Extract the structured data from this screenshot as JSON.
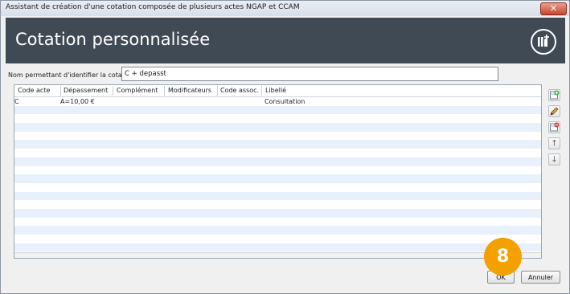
{
  "window": {
    "title": "Assistant de création d'une cotation composée de plusieurs actes NGAP et CCAM",
    "close_symbol": "✕"
  },
  "header": {
    "title": "Cotation personnalisée",
    "logo_icon": "medical-logo-icon"
  },
  "form": {
    "name_label": "Nom permettant d'identifier la cotation :",
    "name_value": "C + depasst"
  },
  "table": {
    "columns": [
      "Code acte",
      "Dépassement",
      "Complément",
      "Modificateurs",
      "Code assoc.",
      "Libellé"
    ],
    "rows": [
      {
        "code_acte": "C",
        "depassement": "A=10,00 €",
        "complement": "",
        "modificateurs": "",
        "code_assoc": "",
        "libelle": "Consultation"
      }
    ]
  },
  "side_toolbar": {
    "add_icon": "add-row-icon",
    "edit_icon": "edit-icon",
    "delete_icon": "delete-icon",
    "up_symbol": "🡑",
    "down_symbol": "🡓"
  },
  "footer": {
    "ok_label": "OK",
    "cancel_label": "Annuler"
  },
  "annotation": {
    "step_number": "8",
    "color": "#f4a000"
  }
}
